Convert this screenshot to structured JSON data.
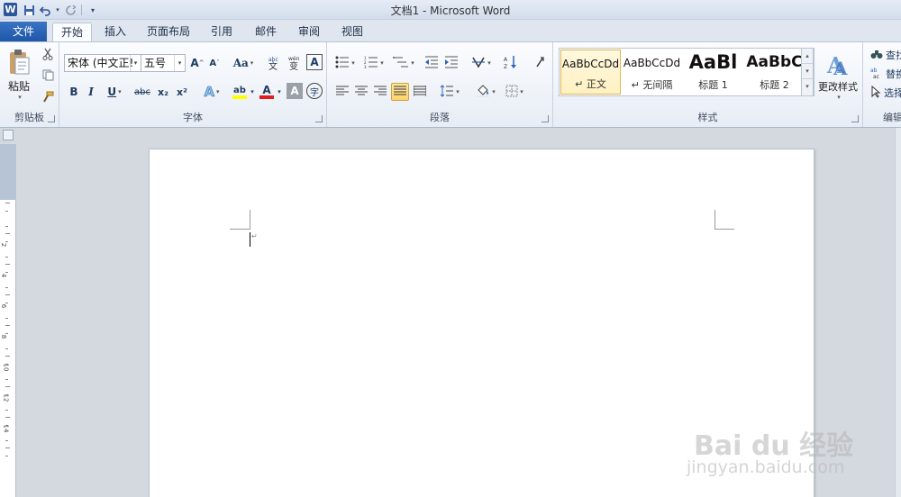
{
  "window": {
    "title": "文档1 - Microsoft Word"
  },
  "app_icon": {
    "letter": "W",
    "icon": "word-app-icon"
  },
  "qat": {
    "save": "save-icon",
    "undo": "undo-icon",
    "redo": "redo-icon",
    "customize": "customize-qat-icon"
  },
  "tabs": {
    "file": "文件",
    "items": [
      "开始",
      "插入",
      "页面布局",
      "引用",
      "邮件",
      "审阅",
      "视图"
    ],
    "active": "开始"
  },
  "clipboard": {
    "paste": "粘贴",
    "group_label": "剪贴板"
  },
  "font": {
    "name": "宋体 (中文正文)",
    "name_display": "宋体 (中文正!",
    "size": "五号",
    "group_label": "字体",
    "bold": "B",
    "italic": "I",
    "underline": "U",
    "strike": "abc",
    "subscript": "x₂",
    "superscript": "x²",
    "grow": "A",
    "shrink": "A",
    "case": "Aa",
    "text_effect": "A",
    "highlight": "ab",
    "font_color": "A",
    "shade": "A",
    "enclose": "字",
    "highlight_color": "#ffff00",
    "font_color_value": "#e31b1b"
  },
  "paragraph": {
    "group_label": "段落"
  },
  "styles": {
    "group_label": "样式",
    "items": [
      {
        "sample": "AaBbCcDd",
        "name": "↵ 正文"
      },
      {
        "sample": "AaBbCcDd",
        "name": "↵ 无间隔"
      },
      {
        "sample": "AaBl",
        "name": "标题 1"
      },
      {
        "sample": "AaBbC",
        "name": "标题 2"
      }
    ],
    "change": "更改样式"
  },
  "editing": {
    "group_label": "编辑",
    "find": "查找",
    "replace": "替换",
    "select": "选择"
  },
  "ruler": {
    "numbers": [
      "4",
      "2",
      "2",
      "4",
      "6",
      "8",
      "10",
      "12",
      "14"
    ]
  },
  "watermark": {
    "brand": "Bai du 经验",
    "url": "jingyan.baidu.com"
  },
  "colors": {
    "accent": "#2b579a",
    "file_tab": "#2c64b4"
  }
}
